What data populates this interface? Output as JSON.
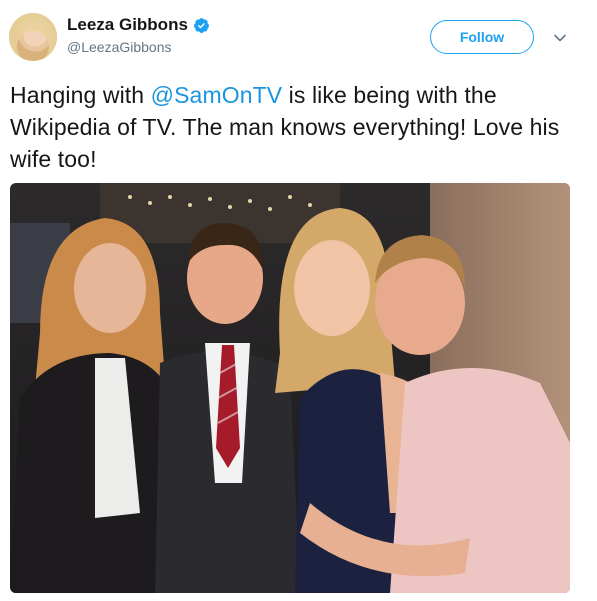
{
  "author": {
    "name": "Leeza Gibbons",
    "handle": "@LeezaGibbons"
  },
  "follow_button": {
    "label": "Follow"
  },
  "tweet": {
    "text_before": "Hanging with ",
    "mention": "@SamOnTV",
    "text_after": " is like being with the Wikipedia of TV. The man knows everything! Love his wife too!"
  },
  "icons": [
    "verified-badge-icon",
    "chevron-down-icon"
  ],
  "colors": {
    "accent": "#1da1f2",
    "mention": "#1b95e0",
    "handle": "#657786",
    "text": "#14171a"
  }
}
